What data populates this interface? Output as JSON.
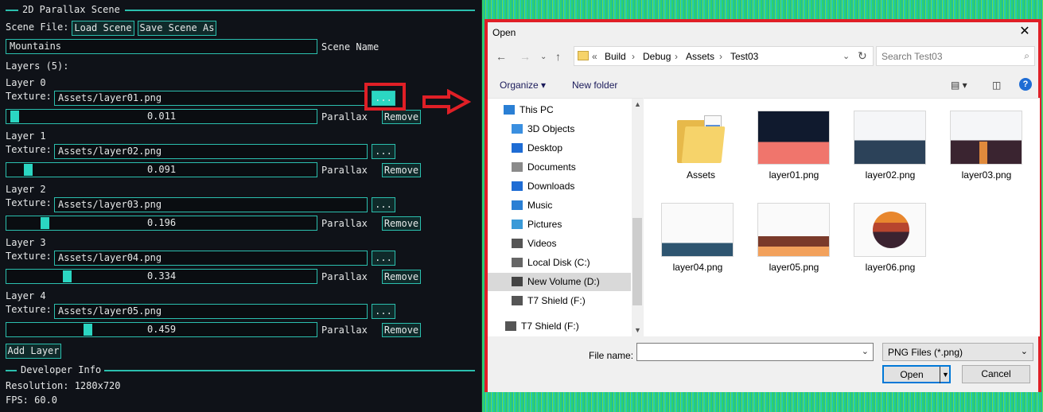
{
  "imgui": {
    "header_title": "2D Parallax Scene",
    "scene_file_label": "Scene File:",
    "load_scene": "Load Scene",
    "save_scene_as": "Save Scene As",
    "scene_name_value": "Mountains",
    "scene_name_label": "Scene Name",
    "layers_label": "Layers (5):",
    "texture_label": "Texture:",
    "browse_label": "...",
    "parallax_label": "Parallax",
    "remove_label": "Remove",
    "layers": [
      {
        "title": "Layer 0",
        "texture": "Assets/layer01.png",
        "parallax": "0.011"
      },
      {
        "title": "Layer 1",
        "texture": "Assets/layer02.png",
        "parallax": "0.091"
      },
      {
        "title": "Layer 2",
        "texture": "Assets/layer03.png",
        "parallax": "0.196"
      },
      {
        "title": "Layer 3",
        "texture": "Assets/layer04.png",
        "parallax": "0.334"
      },
      {
        "title": "Layer 4",
        "texture": "Assets/layer05.png",
        "parallax": "0.459"
      }
    ],
    "add_layer": "Add Layer",
    "dev_header": "Developer Info",
    "resolution": "Resolution: 1280x720",
    "fps": "FPS: 60.0"
  },
  "dialog": {
    "title": "Open",
    "breadcrumb": [
      "Build",
      "Debug",
      "Assets",
      "Test03"
    ],
    "search_placeholder": "Search Test03",
    "organize": "Organize",
    "new_folder": "New folder",
    "nav_items": [
      "This PC",
      "3D Objects",
      "Desktop",
      "Documents",
      "Downloads",
      "Music",
      "Pictures",
      "Videos",
      "Local Disk (C:)",
      "New Volume (D:)",
      "T7 Shield (F:)",
      "T7 Shield (F:)"
    ],
    "files": [
      "Assets",
      "layer01.png",
      "layer02.png",
      "layer03.png",
      "layer04.png",
      "layer05.png",
      "layer06.png"
    ],
    "file_name_label": "File name:",
    "file_type": "PNG Files (*.png)",
    "open_button": "Open",
    "cancel_button": "Cancel"
  },
  "colors": {
    "accent": "#2bbfae",
    "highlight": "#e01f26"
  }
}
